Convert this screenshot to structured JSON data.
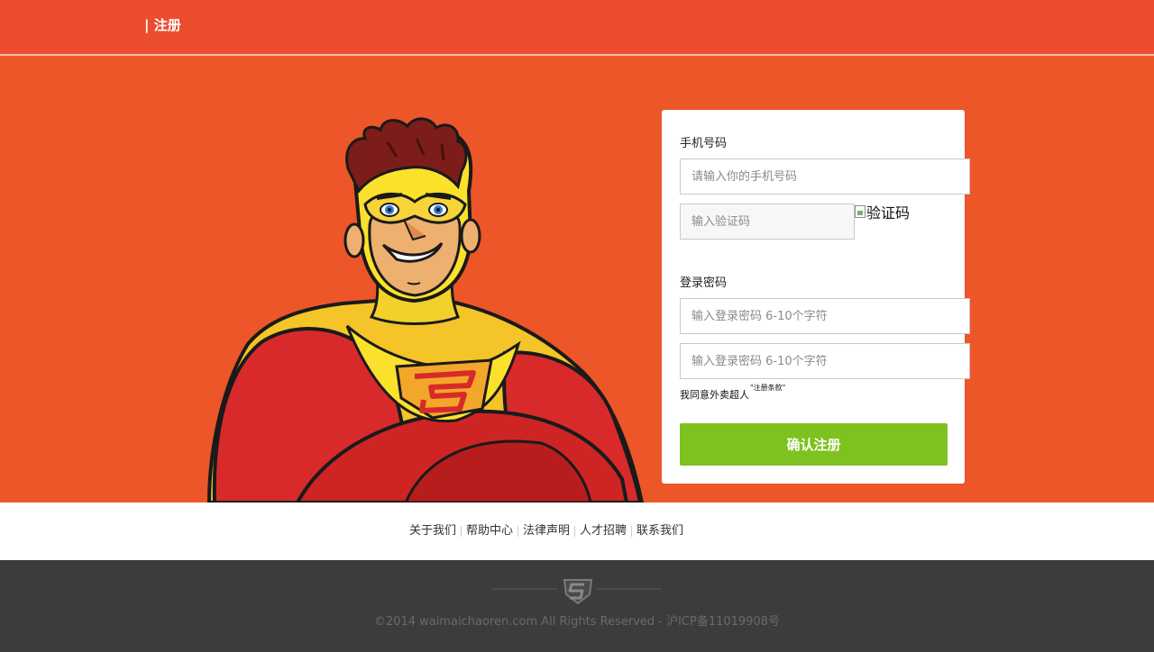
{
  "header": {
    "title": "| 注册"
  },
  "form": {
    "phone_label": "手机号码",
    "phone_placeholder": "请输入你的手机号码",
    "code_placeholder": "输入验证码",
    "captcha_alt": "验证码",
    "password_label": "登录密码",
    "password_placeholder": "输入登录密码 6-10个字符",
    "password_confirm_placeholder": "输入登录密码 6-10个字符",
    "agree_text": "我同意外卖超人",
    "terms_link": "\"注册条款\"",
    "submit_label": "确认注册"
  },
  "footer": {
    "links": [
      "关于我们",
      "帮助中心",
      "法律声明",
      "人才招聘",
      "联系我们"
    ],
    "copyright": "©2014 waimaichaoren.com All Rights Reserved - 沪ICP备11019908号"
  },
  "colors": {
    "header_bg": "#eb4d2e",
    "hero_bg": "#ec5628",
    "submit_bg": "#7dc21e",
    "bottom_bg": "#3c3c3e"
  },
  "icons": {
    "mascot": "superhero-mascot",
    "emblem": "superhero-s-shield-icon"
  }
}
